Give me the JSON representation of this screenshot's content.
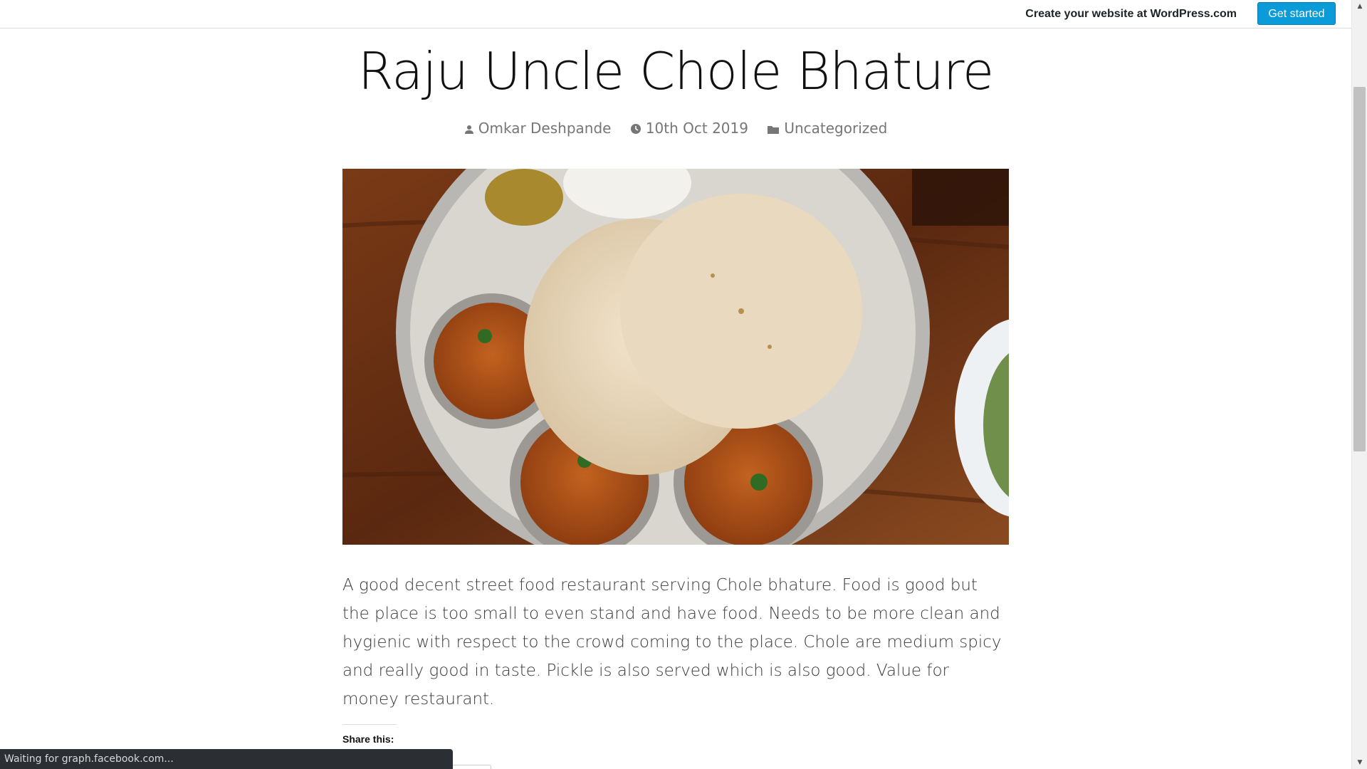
{
  "wp_banner": {
    "create_text": "Create your website at WordPress.com",
    "get_started_label": "Get started"
  },
  "post": {
    "title": "Raju Uncle Chole Bhature",
    "author": "Omkar Deshpande",
    "date": "10th Oct 2019",
    "category": "Uncategorized",
    "body": "A good decent street food restaurant serving Chole bhature. Food is good but the place is too small to even stand and have food. Needs to be more clean and hygienic with respect to the crowd coming to the place. Chole are medium spicy and really good in taste. Pickle is also served which is also good. Value for money restaurant.",
    "share_label": "Share this:"
  },
  "status_bar": {
    "text": "Waiting for graph.facebook.com..."
  },
  "icons": {
    "author": "person-icon",
    "date": "clock-icon",
    "category": "folder-icon"
  },
  "colors": {
    "accent": "#0a9bd8",
    "meta_text": "#767676"
  }
}
